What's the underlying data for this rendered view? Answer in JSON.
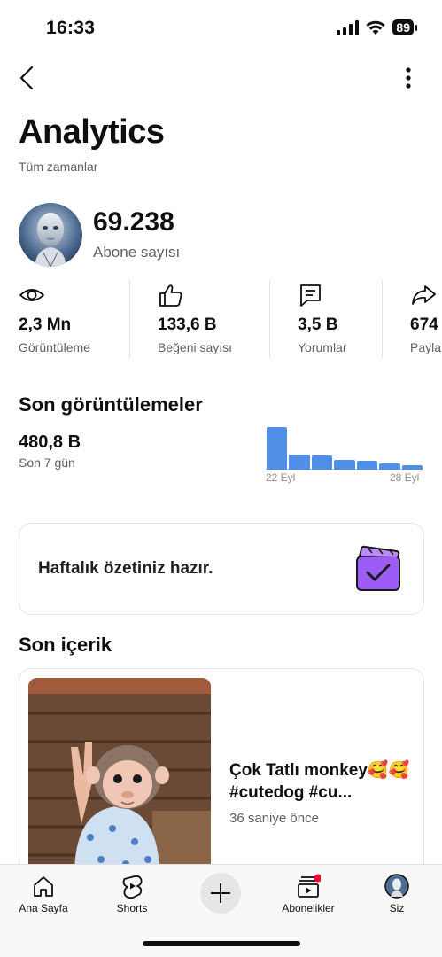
{
  "status_bar": {
    "time": "16:33",
    "battery": "89"
  },
  "header": {
    "title": "Analytics",
    "subtitle": "Tüm zamanlar"
  },
  "channel": {
    "subscriber_count": "69.238",
    "subscriber_label": "Abone sayısı"
  },
  "metrics": [
    {
      "icon": "eye-icon",
      "value": "2,3 Mn",
      "label": "Görüntüleme"
    },
    {
      "icon": "thumbs-up-icon",
      "value": "133,6 B",
      "label": "Beğeni sayısı"
    },
    {
      "icon": "comment-icon",
      "value": "3,5 B",
      "label": "Yorumlar"
    },
    {
      "icon": "share-icon",
      "value": "674",
      "label": "Payla"
    }
  ],
  "recent_views": {
    "title": "Son görüntülemeler",
    "value": "480,8 B",
    "period": "Son 7 gün",
    "chart_start_label": "22 Eyl",
    "chart_end_label": "28 Eyl",
    "bar_color": "#4f8fe8",
    "bars": [
      100,
      36,
      33,
      22,
      20,
      14,
      10
    ]
  },
  "weekly_summary": {
    "text": "Haftalık özetiniz hazır.",
    "icon": "clapperboard-check-icon",
    "accent": "#9c5cf5"
  },
  "recent_content": {
    "title": "Son içerik",
    "video_title": "Çok Tatlı monkey🥰🥰 #cutedog  #cu...",
    "published": "36 saniye önce"
  },
  "bottom_nav": [
    {
      "icon": "home-icon",
      "label": "Ana Sayfa"
    },
    {
      "icon": "shorts-icon",
      "label": "Shorts"
    },
    {
      "icon": "plus-icon",
      "label": ""
    },
    {
      "icon": "subscriptions-icon",
      "label": "Abonelikler"
    },
    {
      "icon": "avatar-icon",
      "label": "Siz"
    }
  ]
}
